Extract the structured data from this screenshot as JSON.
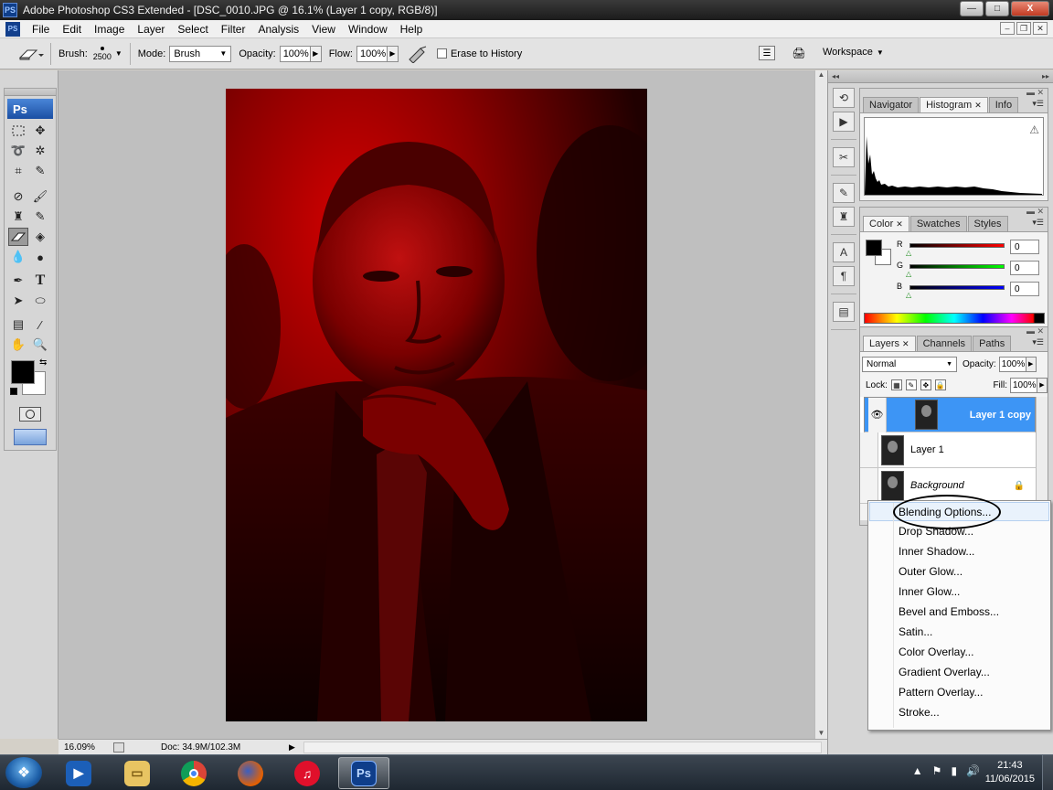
{
  "window": {
    "app_icon": "PS",
    "title": "Adobe Photoshop CS3 Extended - [DSC_0010.JPG @ 16.1% (Layer 1 copy, RGB/8)]",
    "minimize": "—",
    "maximize": "□",
    "close": "X"
  },
  "menu": {
    "items": [
      "File",
      "Edit",
      "Image",
      "Layer",
      "Select",
      "Filter",
      "Analysis",
      "View",
      "Window",
      "Help"
    ]
  },
  "options": {
    "brush_label": "Brush:",
    "brush_size": "2500",
    "mode_label": "Mode:",
    "mode_value": "Brush",
    "opacity_label": "Opacity:",
    "opacity_value": "100%",
    "flow_label": "Flow:",
    "flow_value": "100%",
    "erase_history_label": "Erase to History",
    "workspace_label": "Workspace"
  },
  "toolbox": {
    "logo": "Ps",
    "active_tool": "eraser-tool"
  },
  "status": {
    "zoom": "16.09%",
    "doc": "Doc: 34.9M/102.3M"
  },
  "panels": {
    "histogram_tabs": [
      "Navigator",
      "Histogram",
      "Info"
    ],
    "histogram_active": "Histogram",
    "color_tabs": [
      "Color",
      "Swatches",
      "Styles"
    ],
    "color": {
      "r_label": "R",
      "g_label": "G",
      "b_label": "B",
      "r": "0",
      "g": "0",
      "b": "0",
      "fg": "#000000",
      "bg": "#ffffff"
    },
    "layers_tabs": [
      "Layers",
      "Channels",
      "Paths"
    ],
    "blend_mode": "Normal",
    "opacity_label": "Opacity:",
    "opacity": "100%",
    "lock_label": "Lock:",
    "fill_label": "Fill:",
    "fill": "100%",
    "layers": [
      {
        "name": "Layer 1 copy",
        "visible": true,
        "selected": true
      },
      {
        "name": "Layer 1",
        "visible": false,
        "selected": false
      },
      {
        "name": "Background",
        "visible": false,
        "selected": false,
        "locked": true
      }
    ]
  },
  "context_menu": {
    "items": [
      "Blending Options...",
      "Drop Shadow...",
      "Inner Shadow...",
      "Outer Glow...",
      "Inner Glow...",
      "Bevel and Emboss...",
      "Satin...",
      "Color Overlay...",
      "Gradient Overlay...",
      "Pattern Overlay...",
      "Stroke..."
    ],
    "highlighted": "Blending Options..."
  },
  "taskbar": {
    "apps": [
      "media-player",
      "file-explorer",
      "chrome",
      "firefox",
      "itunes",
      "photoshop"
    ],
    "ps_label": "Ps",
    "time": "21:43",
    "date": "11/06/2015"
  },
  "colors": {
    "image_red": "#b40000",
    "selection_blue": "#3d95f5"
  }
}
